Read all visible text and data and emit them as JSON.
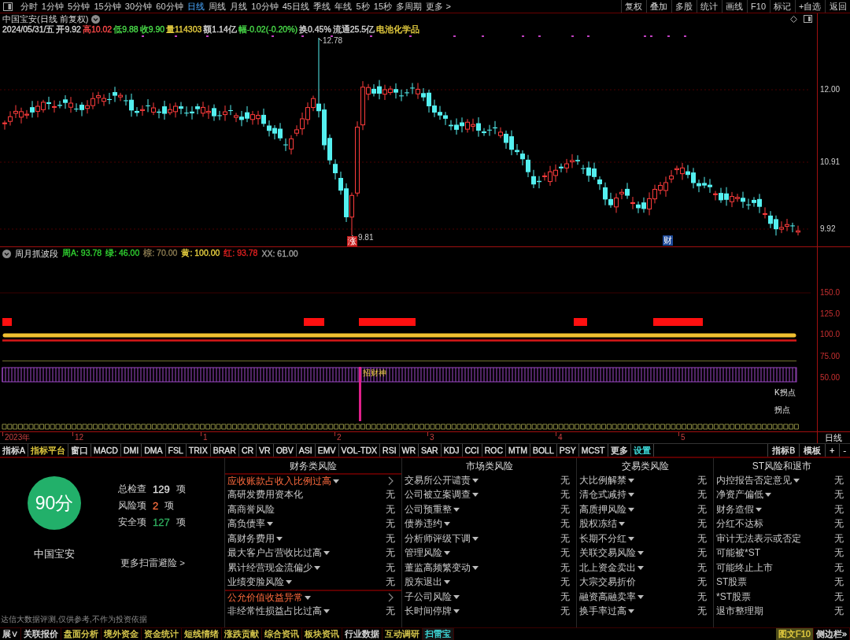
{
  "toolbar": {
    "periods": [
      {
        "label": "分时",
        "selected": false
      },
      {
        "label": "1分钟",
        "selected": false
      },
      {
        "label": "5分钟",
        "selected": false
      },
      {
        "label": "15分钟",
        "selected": false
      },
      {
        "label": "30分钟",
        "selected": false
      },
      {
        "label": "60分钟",
        "selected": false
      },
      {
        "label": "日线",
        "selected": true
      },
      {
        "label": "周线",
        "selected": false
      },
      {
        "label": "月线",
        "selected": false
      },
      {
        "label": "10分钟",
        "selected": false
      },
      {
        "label": "45日线",
        "selected": false
      },
      {
        "label": "季线",
        "selected": false
      },
      {
        "label": "年线",
        "selected": false
      },
      {
        "label": "5秒",
        "selected": false
      },
      {
        "label": "15秒",
        "selected": false
      },
      {
        "label": "多周期",
        "selected": false
      },
      {
        "label": "更多 >",
        "selected": false
      }
    ],
    "actions": [
      "复权",
      "叠加",
      "多股",
      "统计",
      "画线",
      "F10",
      "标记",
      "+自选",
      "返回"
    ]
  },
  "price_chart": {
    "title": "中国宝安(日线 前复权)",
    "quote": [
      {
        "text": "2024/05/31/五",
        "color": "#d8d8d8"
      },
      {
        "text": "开9.92",
        "color": "#d8d8d8"
      },
      {
        "text": "高10.02",
        "color": "#ff4a4a"
      },
      {
        "text": "低9.88",
        "color": "#4ade4a"
      },
      {
        "text": "收9.90",
        "color": "#4ade4a"
      },
      {
        "text": "量114303",
        "color": "#e8d040"
      },
      {
        "text": "额1.14亿",
        "color": "#d8d8d8"
      },
      {
        "text": "幅-0.02(-0.20%)",
        "color": "#4ade4a"
      },
      {
        "text": "换0.45%",
        "color": "#d8d8d8"
      },
      {
        "text": "流通25.5亿",
        "color": "#d8d8d8"
      },
      {
        "text": "电池化学品",
        "color": "#e8d040"
      }
    ],
    "axis_labels": [
      "12.00",
      "10.91",
      "9.92"
    ],
    "high_marker": "12.78",
    "low_marker": "9.81",
    "event_badges": [
      {
        "label": "涨",
        "color": "#c81e1e"
      },
      {
        "label": "财",
        "color": "#1e4a9a"
      }
    ]
  },
  "indicator": {
    "name": "周月抓波段",
    "values": [
      {
        "text": "周A: 93.78",
        "color": "#30d030"
      },
      {
        "text": "绿: 46.00",
        "color": "#30d030"
      },
      {
        "text": "棕: 70.00",
        "color": "#8a7a50"
      },
      {
        "text": "黄: 100.00",
        "color": "#e8d040"
      },
      {
        "text": "红: 93.78",
        "color": "#e02020"
      },
      {
        "text": "XX: 61.00",
        "color": "#a0a0a0"
      }
    ],
    "axis_labels": [
      "150.0",
      "125.0",
      "100.0",
      "75.00",
      "50.00"
    ],
    "signal_label": "招财神",
    "point_labels": [
      "K拐点",
      "拐点"
    ]
  },
  "date_axis": {
    "labels": [
      "2023年",
      "12",
      "1",
      "2",
      "3",
      "4",
      "5"
    ],
    "period": "日线"
  },
  "indicator_tabs": {
    "left": [
      {
        "label": "指标A",
        "color": "#e0e0e0"
      },
      {
        "label": "指标平台",
        "color": "#e8d040"
      },
      {
        "label": "窗口",
        "color": "#e0e0e0"
      },
      {
        "label": "MACD",
        "color": "#e0e0e0"
      },
      {
        "label": "DMI",
        "color": "#e0e0e0"
      },
      {
        "label": "DMA",
        "color": "#e0e0e0"
      },
      {
        "label": "FSL",
        "color": "#e0e0e0"
      },
      {
        "label": "TRIX",
        "color": "#e0e0e0"
      },
      {
        "label": "BRAR",
        "color": "#e0e0e0"
      },
      {
        "label": "CR",
        "color": "#e0e0e0"
      },
      {
        "label": "VR",
        "color": "#e0e0e0"
      },
      {
        "label": "OBV",
        "color": "#e0e0e0"
      },
      {
        "label": "ASI",
        "color": "#e0e0e0"
      },
      {
        "label": "EMV",
        "color": "#e0e0e0"
      },
      {
        "label": "VOL-TDX",
        "color": "#e0e0e0"
      },
      {
        "label": "RSI",
        "color": "#e0e0e0"
      },
      {
        "label": "WR",
        "color": "#e0e0e0"
      },
      {
        "label": "SAR",
        "color": "#e0e0e0"
      },
      {
        "label": "KDJ",
        "color": "#e0e0e0"
      },
      {
        "label": "CCI",
        "color": "#e0e0e0"
      },
      {
        "label": "ROC",
        "color": "#e0e0e0"
      },
      {
        "label": "MTM",
        "color": "#e0e0e0"
      },
      {
        "label": "BOLL",
        "color": "#e0e0e0"
      },
      {
        "label": "PSY",
        "color": "#e0e0e0"
      },
      {
        "label": "MCST",
        "color": "#e0e0e0"
      },
      {
        "label": "更多",
        "color": "#e0e0e0"
      },
      {
        "label": "设置",
        "color": "#40e0e0"
      }
    ],
    "right": [
      "指标B",
      "模板",
      "+",
      "-"
    ]
  },
  "risk_scan": {
    "summary": {
      "score": "90分",
      "name": "中国宝安",
      "stats": [
        {
          "label": "总检查",
          "count": "129",
          "unit": "项",
          "color": "#e0e0e0"
        },
        {
          "label": "风险项",
          "count": "2",
          "unit": "项",
          "color": "#ff7040"
        },
        {
          "label": "安全项",
          "count": "127",
          "unit": "项",
          "color": "#30b060"
        }
      ],
      "more_link": "更多扫雷避险 >",
      "disclaimer": "达信大数据评测,仅供参考,不作为投资依据"
    },
    "columns": [
      {
        "title": "财务类风险",
        "items": [
          {
            "label": "应收账款占收入比例过高",
            "dropdown": true,
            "risk": true
          },
          {
            "label": "高研发费用资本化",
            "dropdown": false,
            "risk": false,
            "value": "无"
          },
          {
            "label": "高商誉风险",
            "dropdown": false,
            "risk": false,
            "value": "无"
          },
          {
            "label": "高负债率",
            "dropdown": true,
            "risk": false,
            "value": "无"
          },
          {
            "label": "高财务费用",
            "dropdown": true,
            "risk": false,
            "value": "无"
          },
          {
            "label": "最大客户占营收比过高",
            "dropdown": true,
            "risk": false,
            "value": "无"
          },
          {
            "label": "累计经营现金流偏少",
            "dropdown": true,
            "risk": false,
            "value": "无"
          },
          {
            "label": "业绩变脸风险",
            "dropdown": true,
            "risk": false,
            "value": "无"
          },
          {
            "label": "公允价值收益异常",
            "dropdown": true,
            "risk": true
          },
          {
            "label": "非经常性损益占比过高",
            "dropdown": true,
            "risk": false,
            "value": "无"
          }
        ]
      },
      {
        "title": "市场类风险",
        "items": [
          {
            "label": "交易所公开谴责",
            "dropdown": true,
            "risk": false,
            "value": "无"
          },
          {
            "label": "公司被立案调查",
            "dropdown": true,
            "risk": false,
            "value": "无"
          },
          {
            "label": "公司预重整",
            "dropdown": true,
            "risk": false,
            "value": "无"
          },
          {
            "label": "债券违约",
            "dropdown": true,
            "risk": false,
            "value": "无"
          },
          {
            "label": "分析师评级下调",
            "dropdown": true,
            "risk": false,
            "value": "无"
          },
          {
            "label": "管理风险",
            "dropdown": true,
            "risk": false,
            "value": "无"
          },
          {
            "label": "董监高频繁变动",
            "dropdown": true,
            "risk": false,
            "value": "无"
          },
          {
            "label": "股东退出",
            "dropdown": true,
            "risk": false,
            "value": "无"
          },
          {
            "label": "子公司风险",
            "dropdown": true,
            "risk": false,
            "value": "无"
          },
          {
            "label": "长时间停牌",
            "dropdown": true,
            "risk": false,
            "value": "无"
          }
        ]
      },
      {
        "title": "交易类风险",
        "items": [
          {
            "label": "大比例解禁",
            "dropdown": true,
            "risk": false,
            "value": "无"
          },
          {
            "label": "清仓式减持",
            "dropdown": true,
            "risk": false,
            "value": "无"
          },
          {
            "label": "高质押风险",
            "dropdown": true,
            "risk": false,
            "value": "无"
          },
          {
            "label": "股权冻结",
            "dropdown": true,
            "risk": false,
            "value": "无"
          },
          {
            "label": "长期不分红",
            "dropdown": true,
            "risk": false,
            "value": "无"
          },
          {
            "label": "关联交易风险",
            "dropdown": true,
            "risk": false,
            "value": "无"
          },
          {
            "label": "北上资金卖出",
            "dropdown": true,
            "risk": false,
            "value": "无"
          },
          {
            "label": "大宗交易折价",
            "dropdown": false,
            "risk": false,
            "value": "无"
          },
          {
            "label": "融资高融卖率",
            "dropdown": true,
            "risk": false,
            "value": "无"
          },
          {
            "label": "换手率过高",
            "dropdown": true,
            "risk": false,
            "value": "无"
          }
        ]
      },
      {
        "title": "ST风险和退市",
        "items": [
          {
            "label": "内控报告否定意见",
            "dropdown": true,
            "risk": false,
            "value": "无"
          },
          {
            "label": "净资产偏低",
            "dropdown": true,
            "risk": false,
            "value": "无"
          },
          {
            "label": "财务造假",
            "dropdown": true,
            "risk": false,
            "value": "无"
          },
          {
            "label": "分红不达标",
            "dropdown": false,
            "risk": false,
            "value": "无"
          },
          {
            "label": "审计无法表示或否定",
            "dropdown": false,
            "risk": false,
            "value": "无"
          },
          {
            "label": "可能被*ST",
            "dropdown": false,
            "risk": false,
            "value": "无"
          },
          {
            "label": "可能终止上市",
            "dropdown": false,
            "risk": false,
            "value": "无"
          },
          {
            "label": "ST股票",
            "dropdown": false,
            "risk": false,
            "value": "无"
          },
          {
            "label": "*ST股票",
            "dropdown": false,
            "risk": false,
            "value": "无"
          },
          {
            "label": "退市整理期",
            "dropdown": false,
            "risk": false,
            "value": "无"
          }
        ]
      }
    ]
  },
  "bottom_tabs": {
    "left": [
      {
        "label": "展∨",
        "color": "#e0e0e0",
        "selected": false
      },
      {
        "label": "关联报价",
        "color": "#e0e0e0",
        "selected": false
      },
      {
        "label": "盘面分析",
        "color": "#e0d050",
        "selected": false
      },
      {
        "label": "境外资金",
        "color": "#e0d050",
        "selected": false
      },
      {
        "label": "资金统计",
        "color": "#e0d050",
        "selected": false
      },
      {
        "label": "短线情绪",
        "color": "#e0d050",
        "selected": false
      },
      {
        "label": "涨跌贡献",
        "color": "#e0d050",
        "selected": false
      },
      {
        "label": "综合资讯",
        "color": "#e0d050",
        "selected": false
      },
      {
        "label": "板块资讯",
        "color": "#e0d050",
        "selected": false
      },
      {
        "label": "行业数据",
        "color": "#e0e0e0",
        "selected": false
      },
      {
        "label": "互动调研",
        "color": "#e0d050",
        "selected": false
      },
      {
        "label": "扫雷宝",
        "color": "#40e0e0",
        "selected": true
      }
    ],
    "right": [
      {
        "label": "图文F10",
        "kind": "highlight"
      },
      {
        "label": "侧边栏»",
        "kind": "plain"
      }
    ]
  }
}
